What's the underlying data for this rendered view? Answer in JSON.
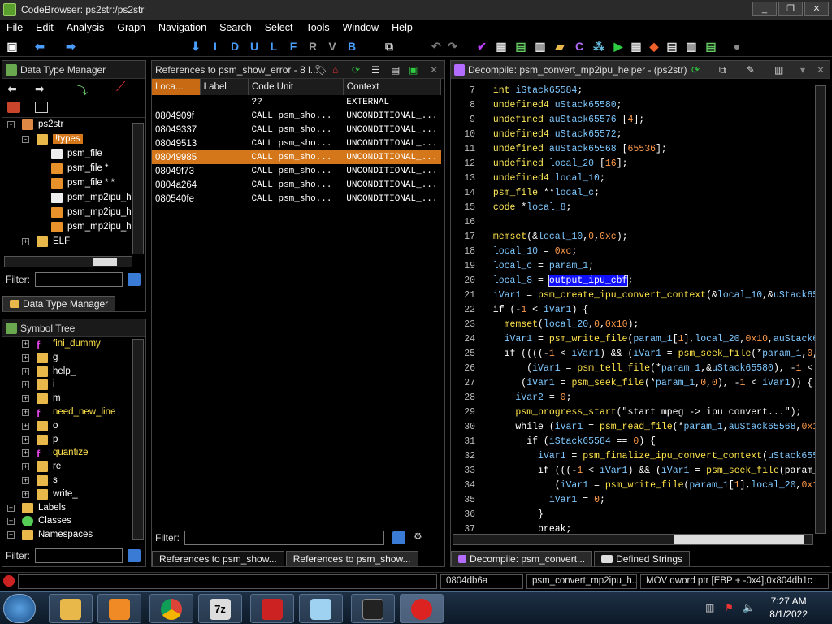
{
  "window": {
    "title": "CodeBrowser: ps2str:/ps2str",
    "controls": [
      "_",
      "❐",
      "✕"
    ]
  },
  "menu": [
    "File",
    "Edit",
    "Analysis",
    "Graph",
    "Navigation",
    "Search",
    "Select",
    "Tools",
    "Window",
    "Help"
  ],
  "toolbar": {
    "letters": [
      "I",
      "D",
      "U",
      "L",
      "F",
      "R",
      "V",
      "B"
    ]
  },
  "dtm": {
    "title": "Data Type Manager",
    "tree": [
      {
        "label": "ps2str",
        "icon": "program-icon",
        "level": 0,
        "exp": "-"
      },
      {
        "label": "!types",
        "icon": "folder-icon",
        "level": 1,
        "exp": "-",
        "selected": true
      },
      {
        "label": "psm_file",
        "icon": "struct-icon",
        "level": 2
      },
      {
        "label": "psm_file *",
        "icon": "pointer-icon",
        "level": 2
      },
      {
        "label": "psm_file * *",
        "icon": "pointer-icon",
        "level": 2
      },
      {
        "label": "psm_mp2ipu_h",
        "icon": "struct-icon",
        "level": 2
      },
      {
        "label": "psm_mp2ipu_h",
        "icon": "pointer-icon",
        "level": 2
      },
      {
        "label": "psm_mp2ipu_h",
        "icon": "pointer-icon",
        "level": 2
      },
      {
        "label": "ELF",
        "icon": "folder-icon",
        "level": 1,
        "exp": "+"
      }
    ],
    "filter_label": "Filter:",
    "tab": "Data Type Manager"
  },
  "symtree": {
    "title": "Symbol Tree",
    "items": [
      {
        "label": "fini_dummy",
        "kind": "function",
        "level": 1
      },
      {
        "label": "g",
        "kind": "folder",
        "level": 1
      },
      {
        "label": "help_",
        "kind": "folder",
        "level": 1
      },
      {
        "label": "i",
        "kind": "folder",
        "level": 1
      },
      {
        "label": "m",
        "kind": "folder",
        "level": 1
      },
      {
        "label": "need_new_line",
        "kind": "function",
        "level": 1
      },
      {
        "label": "o",
        "kind": "folder",
        "level": 1
      },
      {
        "label": "p",
        "kind": "folder",
        "level": 1
      },
      {
        "label": "quantize",
        "kind": "function",
        "level": 1
      },
      {
        "label": "re",
        "kind": "folder",
        "level": 1
      },
      {
        "label": "s",
        "kind": "folder",
        "level": 1
      },
      {
        "label": "write_",
        "kind": "folder",
        "level": 1
      },
      {
        "label": "Labels",
        "kind": "folder",
        "level": 0
      },
      {
        "label": "Classes",
        "kind": "classes",
        "level": 0
      },
      {
        "label": "Namespaces",
        "kind": "folder",
        "level": 0
      }
    ],
    "filter_label": "Filter:"
  },
  "refs": {
    "title": "References to psm_show_error - 8 l...",
    "columns": [
      "Loca...",
      "Label",
      "Code Unit",
      "Context"
    ],
    "rows": [
      {
        "loc": "",
        "label": "",
        "code": "??",
        "ctx": "EXTERNAL"
      },
      {
        "loc": "0804909f",
        "label": "",
        "code": "CALL psm_sho...",
        "ctx": "UNCONDITIONAL_..."
      },
      {
        "loc": "08049337",
        "label": "",
        "code": "CALL psm_sho...",
        "ctx": "UNCONDITIONAL_..."
      },
      {
        "loc": "08049513",
        "label": "",
        "code": "CALL psm_sho...",
        "ctx": "UNCONDITIONAL_..."
      },
      {
        "loc": "08049985",
        "label": "",
        "code": "CALL psm_sho...",
        "ctx": "UNCONDITIONAL_...",
        "selected": true
      },
      {
        "loc": "08049f73",
        "label": "",
        "code": "CALL psm_sho...",
        "ctx": "UNCONDITIONAL_..."
      },
      {
        "loc": "0804a264",
        "label": "",
        "code": "CALL psm_sho...",
        "ctx": "UNCONDITIONAL_..."
      },
      {
        "loc": "080540fe",
        "label": "",
        "code": "CALL psm_sho...",
        "ctx": "UNCONDITIONAL_..."
      }
    ],
    "filter_label": "Filter:",
    "tabs": [
      "References to psm_show...",
      "References to psm_show..."
    ]
  },
  "decomp": {
    "title": "Decompile: psm_convert_mp2ipu_helper - (ps2str)",
    "lines": [
      {
        "n": "7",
        "t": "  int iStack65584;"
      },
      {
        "n": "8",
        "t": "  undefined4 uStack65580;"
      },
      {
        "n": "9",
        "t": "  undefined auStack65576 [4];"
      },
      {
        "n": "10",
        "t": "  undefined4 uStack65572;"
      },
      {
        "n": "11",
        "t": "  undefined auStack65568 [65536];"
      },
      {
        "n": "12",
        "t": "  undefined local_20 [16];"
      },
      {
        "n": "13",
        "t": "  undefined4 local_10;"
      },
      {
        "n": "14",
        "t": "  psm_file **local_c;"
      },
      {
        "n": "15",
        "t": "  code *local_8;"
      },
      {
        "n": "16",
        "t": ""
      },
      {
        "n": "17",
        "t": "  memset(&local_10,0,0xc);"
      },
      {
        "n": "18",
        "t": "  local_10 = 0xc;"
      },
      {
        "n": "19",
        "t": "  local_c = param_1;"
      },
      {
        "n": "20",
        "t": "  local_8 = output_ipu_cbf;",
        "hl": "output_ipu_cbf"
      },
      {
        "n": "21",
        "t": "  iVar1 = psm_create_ipu_convert_context(&local_10,&uStack65"
      },
      {
        "n": "22",
        "t": "  if (-1 < iVar1) {"
      },
      {
        "n": "23",
        "t": "    memset(local_20,0,0x10);"
      },
      {
        "n": "24",
        "t": "    iVar1 = psm_write_file(param_1[1],local_20,0x10,auStack6"
      },
      {
        "n": "25",
        "t": "    if ((((-1 < iVar1) && (iVar1 = psm_seek_file(*param_1,0,"
      },
      {
        "n": "26",
        "t": "        (iVar1 = psm_tell_file(*param_1,&uStack65580), -1 <"
      },
      {
        "n": "27",
        "t": "       (iVar1 = psm_seek_file(*param_1,0,0), -1 < iVar1)) {"
      },
      {
        "n": "28",
        "t": "      iVar2 = 0;"
      },
      {
        "n": "29",
        "t": "      psm_progress_start(\"start mpeg -> ipu convert...\");"
      },
      {
        "n": "30",
        "t": "      while (iVar1 = psm_read_file(*param_1,auStack65568,0x1"
      },
      {
        "n": "31",
        "t": "        if (iStack65584 == 0) {"
      },
      {
        "n": "32",
        "t": "          iVar1 = psm_finalize_ipu_convert_context(uStack655"
      },
      {
        "n": "33",
        "t": "          if (((-1 < iVar1) && (iVar1 = psm_seek_file(param_"
      },
      {
        "n": "34",
        "t": "             (iVar1 = psm_write_file(param_1[1],local_20,0x1"
      },
      {
        "n": "35",
        "t": "            iVar1 = 0;"
      },
      {
        "n": "36",
        "t": "          }"
      },
      {
        "n": "37",
        "t": "          break;"
      }
    ],
    "tabs": [
      "Decompile: psm_convert...",
      "Defined Strings"
    ]
  },
  "status": {
    "address": "0804db6a",
    "function": "psm_convert_mp2ipu_h...",
    "instruction": "MOV dword ptr [EBP + -0x4],0x804db1c"
  },
  "taskbar": {
    "apps": [
      "windows-explorer",
      "media-player",
      "chrome",
      "7zip",
      "ghidra-dragon",
      "notepad",
      "console",
      "ghidra"
    ],
    "time": "7:27 AM",
    "date": "8/1/2022"
  }
}
